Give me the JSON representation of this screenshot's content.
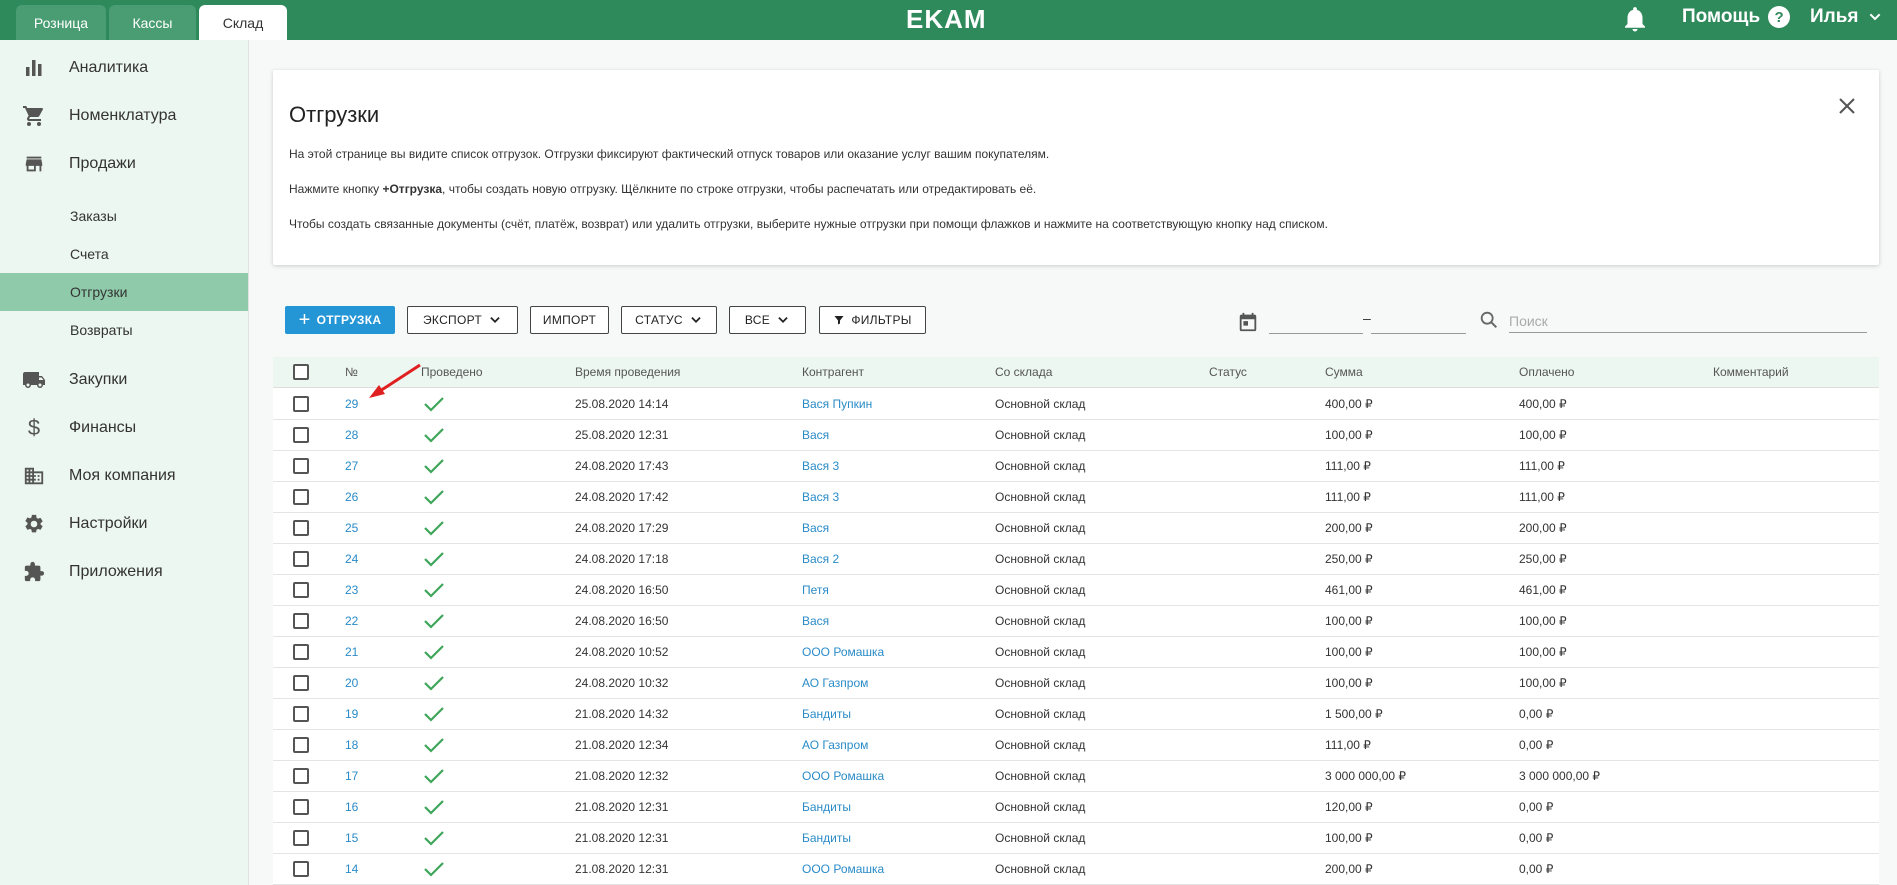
{
  "topbar": {
    "tabs": [
      {
        "label": "Розница"
      },
      {
        "label": "Кассы"
      },
      {
        "label": "Склад"
      }
    ],
    "logo": "EKAM",
    "help_label": "Помощь",
    "help_icon": "?",
    "user_name": "Илья"
  },
  "sidebar": {
    "items": [
      {
        "label": "Аналитика",
        "icon": "bar-chart-icon"
      },
      {
        "label": "Номенклатура",
        "icon": "cart-icon"
      },
      {
        "label": "Продажи",
        "icon": "store-icon"
      },
      {
        "label": "Закупки",
        "icon": "truck-icon"
      },
      {
        "label": "Финансы",
        "icon": "dollar-icon"
      },
      {
        "label": "Моя компания",
        "icon": "building-icon"
      },
      {
        "label": "Настройки",
        "icon": "gear-icon"
      },
      {
        "label": "Приложения",
        "icon": "puzzle-icon"
      }
    ],
    "sales_sub": [
      {
        "label": "Заказы"
      },
      {
        "label": "Счета"
      },
      {
        "label": "Отгрузки"
      },
      {
        "label": "Возвраты"
      }
    ]
  },
  "info": {
    "title": "Отгрузки",
    "p1": "На этой странице вы видите список отгрузок. Отгрузки фиксируют фактический отпуск товаров или оказание услуг вашим покупателям.",
    "p2_pre": "Нажмите кнопку ",
    "p2_bold": "+Отгрузка",
    "p2_post": ", чтобы создать новую отгрузку. Щёлкните по строке отгрузки, чтобы распечатать или отредактировать её.",
    "p3": "Чтобы создать связанные документы (счёт, платёж, возврат) или удалить отгрузки, выберите нужные отгрузки при помощи флажков и нажмите на соответствующую кнопку над списком."
  },
  "toolbar": {
    "add_label": "ОТГРУЗКА",
    "export_label": "ЭКСПОРТ",
    "import_label": "ИМПОРТ",
    "status_label": "СТАТУС",
    "all_label": "ВСЕ",
    "filters_label": "ФИЛЬТРЫ",
    "date_separator": "–",
    "search_placeholder": "Поиск"
  },
  "table": {
    "headers": {
      "num": "№",
      "posted": "Проведено",
      "time": "Время проведения",
      "contractor": "Контрагент",
      "warehouse": "Со склада",
      "status": "Статус",
      "sum": "Сумма",
      "paid": "Оплачено",
      "comment": "Комментарий"
    },
    "rows": [
      {
        "num": "29",
        "time": "25.08.2020 14:14",
        "contractor": "Вася Пупкин",
        "warehouse": "Основной склад",
        "sum": "400,00 ₽",
        "paid": "400,00 ₽"
      },
      {
        "num": "28",
        "time": "25.08.2020 12:31",
        "contractor": "Вася",
        "warehouse": "Основной склад",
        "sum": "100,00 ₽",
        "paid": "100,00 ₽"
      },
      {
        "num": "27",
        "time": "24.08.2020 17:43",
        "contractor": "Вася 3",
        "warehouse": "Основной склад",
        "sum": "111,00 ₽",
        "paid": "111,00 ₽"
      },
      {
        "num": "26",
        "time": "24.08.2020 17:42",
        "contractor": "Вася 3",
        "warehouse": "Основной склад",
        "sum": "111,00 ₽",
        "paid": "111,00 ₽"
      },
      {
        "num": "25",
        "time": "24.08.2020 17:29",
        "contractor": "Вася",
        "warehouse": "Основной склад",
        "sum": "200,00 ₽",
        "paid": "200,00 ₽"
      },
      {
        "num": "24",
        "time": "24.08.2020 17:18",
        "contractor": "Вася 2",
        "warehouse": "Основной склад",
        "sum": "250,00 ₽",
        "paid": "250,00 ₽"
      },
      {
        "num": "23",
        "time": "24.08.2020 16:50",
        "contractor": "Петя",
        "warehouse": "Основной склад",
        "sum": "461,00 ₽",
        "paid": "461,00 ₽"
      },
      {
        "num": "22",
        "time": "24.08.2020 16:50",
        "contractor": "Вася",
        "warehouse": "Основной склад",
        "sum": "100,00 ₽",
        "paid": "100,00 ₽"
      },
      {
        "num": "21",
        "time": "24.08.2020 10:52",
        "contractor": "ООО Ромашка",
        "warehouse": "Основной склад",
        "sum": "100,00 ₽",
        "paid": "100,00 ₽"
      },
      {
        "num": "20",
        "time": "24.08.2020 10:32",
        "contractor": "АО Газпром",
        "warehouse": "Основной склад",
        "sum": "100,00 ₽",
        "paid": "100,00 ₽"
      },
      {
        "num": "19",
        "time": "21.08.2020 14:32",
        "contractor": "Бандиты",
        "warehouse": "Основной склад",
        "sum": "1 500,00 ₽",
        "paid": "0,00 ₽"
      },
      {
        "num": "18",
        "time": "21.08.2020 12:34",
        "contractor": "АО Газпром",
        "warehouse": "Основной склад",
        "sum": "111,00 ₽",
        "paid": "0,00 ₽"
      },
      {
        "num": "17",
        "time": "21.08.2020 12:32",
        "contractor": "ООО Ромашка",
        "warehouse": "Основной склад",
        "sum": "3 000 000,00 ₽",
        "paid": "3 000 000,00 ₽"
      },
      {
        "num": "16",
        "time": "21.08.2020 12:31",
        "contractor": "Бандиты",
        "warehouse": "Основной склад",
        "sum": "120,00 ₽",
        "paid": "0,00 ₽"
      },
      {
        "num": "15",
        "time": "21.08.2020 12:31",
        "contractor": "Бандиты",
        "warehouse": "Основной склад",
        "sum": "100,00 ₽",
        "paid": "0,00 ₽"
      },
      {
        "num": "14",
        "time": "21.08.2020 12:31",
        "contractor": "ООО Ромашка",
        "warehouse": "Основной склад",
        "sum": "200,00 ₽",
        "paid": "0,00 ₽"
      }
    ]
  },
  "colors": {
    "brand": "#2e8a5b",
    "link": "#2a8bc7",
    "primary_button": "#2496d6",
    "check": "#3ea55a",
    "annotation_arrow": "#e02020"
  }
}
